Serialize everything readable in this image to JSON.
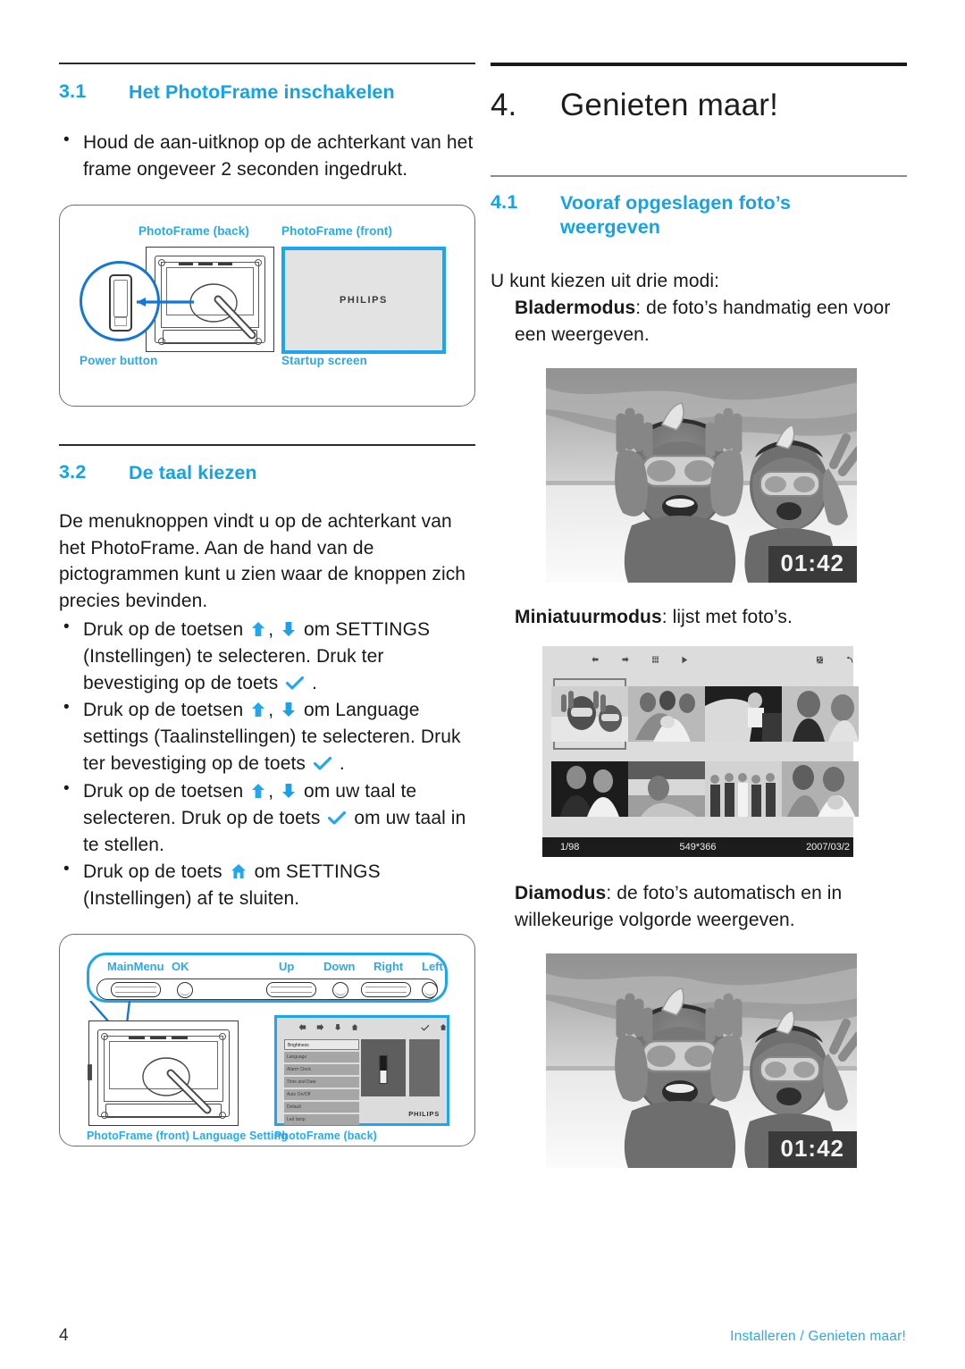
{
  "accent_color": "#14a3e8",
  "caption_color": "#2aa9ec",
  "left_column": {
    "section_3_1": {
      "number": "3.1",
      "title": "Het PhotoFrame inschakelen",
      "bullets": [
        "Houd de aan-uitknop op de achterkant van het frame ongeveer 2 seconden ingedrukt."
      ]
    },
    "figure_power": {
      "caption_back": "PhotoFrame (back)",
      "caption_front": "PhotoFrame (front)",
      "label_power_button": "Power button",
      "label_startup_screen": "Startup screen",
      "screen_brand": "PHILIPS"
    },
    "section_3_2": {
      "number": "3.2",
      "title": "De taal kiezen",
      "intro": "De menuknoppen vindt u op de achterkant van het PhotoFrame. Aan de hand van de pictogrammen kunt u zien waar de knoppen zich precies bevinden.",
      "bullets": [
        {
          "part1": "Druk op de toetsen",
          "icon1": "arrow-up-icon",
          "sep": ",",
          "icon2": "arrow-down-icon",
          "part2": "om SETTINGS (Instellingen) te selecteren. Druk ter bevestiging op de toets",
          "icon3": "check-icon",
          "part3": "."
        },
        {
          "part1": "Druk op de toetsen",
          "icon1": "arrow-up-icon",
          "sep": ",",
          "icon2": "arrow-down-icon",
          "part2": "om Language settings (Taalinstellingen) te selecteren. Druk ter bevestiging op de toets",
          "icon3": "check-icon",
          "part3": "."
        },
        {
          "part1": "Druk op de toetsen",
          "icon1": "arrow-up-icon",
          "sep": ",",
          "icon2": "arrow-down-icon",
          "part2": "om uw taal te selecteren. Druk op de toets",
          "icon3": "check-icon",
          "part3": "om uw taal in te stellen."
        },
        {
          "part1": "Druk op de toets",
          "icon1": "home-icon",
          "part2": "om SETTINGS (Instellingen) af te sluiten."
        }
      ]
    },
    "figure_buttons": {
      "button_labels": [
        "MainMenu",
        "OK",
        "Up",
        "Down",
        "Right",
        "Left"
      ],
      "caption_left": "PhotoFrame (front) Language Setting",
      "caption_right": "PhotoFrame (back)",
      "settings_menu_items": [
        "Brightness",
        "Language",
        "Alarm Clock",
        "Time and Date",
        "Auto On/Off",
        "Default",
        "Led lamp"
      ],
      "screen_brand": "PHILIPS",
      "topbar_icons": [
        "arrow-left-icon",
        "arrow-right-icon",
        "arrow-down-icon",
        "home-icon",
        "check-icon",
        "exit-icon"
      ]
    }
  },
  "right_column": {
    "chapter": {
      "number": "4.",
      "title": "Genieten maar!"
    },
    "section_4_1": {
      "number": "4.1",
      "title_line1": "Vooraf opgeslagen foto’s",
      "title_line2": "weergeven",
      "intro": "U kunt kiezen uit drie modi:",
      "mode_browse": {
        "name": "Bladermodus",
        "desc": ": de foto’s handmatig een voor een weergeven."
      },
      "mode_thumb": {
        "name": "Miniatuurmodus",
        "desc": ": lijst met foto’s."
      },
      "mode_slide": {
        "name": "Diamodus",
        "desc": ": de foto’s automatisch en in willekeurige volgorde weergeven."
      }
    },
    "photo_browse": {
      "time": "01:42"
    },
    "photo_slide": {
      "time": "01:42"
    },
    "thumbnail_screen": {
      "toolbar_icons": [
        "arrow-left-icon",
        "arrow-right-icon",
        "list-icon",
        "play-icon",
        "exposure-icon",
        "undo-icon"
      ],
      "status": {
        "counter": "1/98",
        "resolution": "549*366",
        "date": "2007/03/2"
      }
    }
  },
  "footer": {
    "page_number": "4",
    "breadcrumb": "Installeren / Genieten maar!"
  }
}
